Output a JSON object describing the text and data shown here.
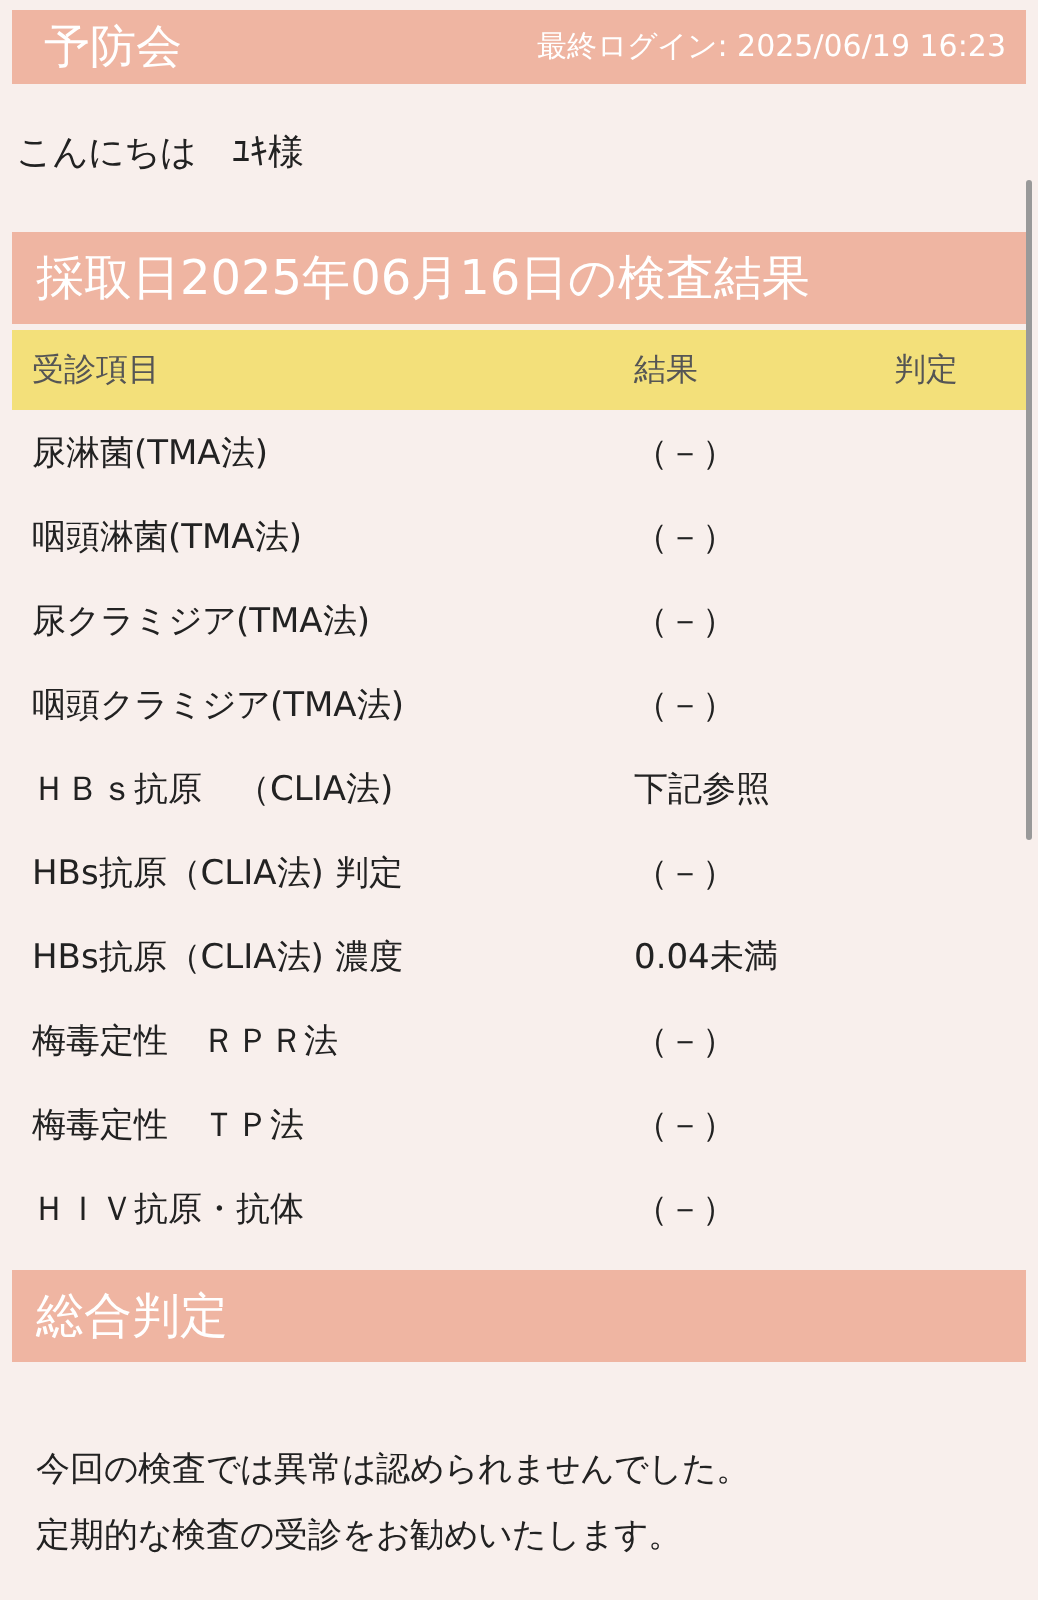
{
  "header": {
    "logo": "予防会",
    "last_login": "最終ログイン: 2025/06/19 16:23"
  },
  "greeting": "こんにちは　ﾕｷ様",
  "results_section": {
    "title": "採取日2025年06月16日の検査結果",
    "columns": [
      "受診項目",
      "結果",
      "判定"
    ],
    "rows": [
      {
        "item": "尿淋菌(TMA法)",
        "result": "（－）"
      },
      {
        "item": "咽頭淋菌(TMA法)",
        "result": "（－）"
      },
      {
        "item": "尿クラミジア(TMA法)",
        "result": "（－）"
      },
      {
        "item": "咽頭クラミジア(TMA法)",
        "result": "（－）"
      },
      {
        "item": "ＨＢｓ抗原　（CLIA法)",
        "result": "下記参照"
      },
      {
        "item": "HBs抗原（CLIA法) 判定",
        "result": "（－）"
      },
      {
        "item": "HBs抗原（CLIA法) 濃度",
        "result": "0.04未満"
      },
      {
        "item": "梅毒定性　ＲＰＲ法",
        "result": "（－）"
      },
      {
        "item": "梅毒定性　ＴＰ法",
        "result": "（－）"
      },
      {
        "item": "ＨＩＶ抗原・抗体",
        "result": "（－）"
      }
    ]
  },
  "summary_section": {
    "title": "総合判定",
    "message": [
      "今回の検査では異常は認められませんでした。",
      "定期的な検査の受診をお勧めいたします。"
    ]
  }
}
